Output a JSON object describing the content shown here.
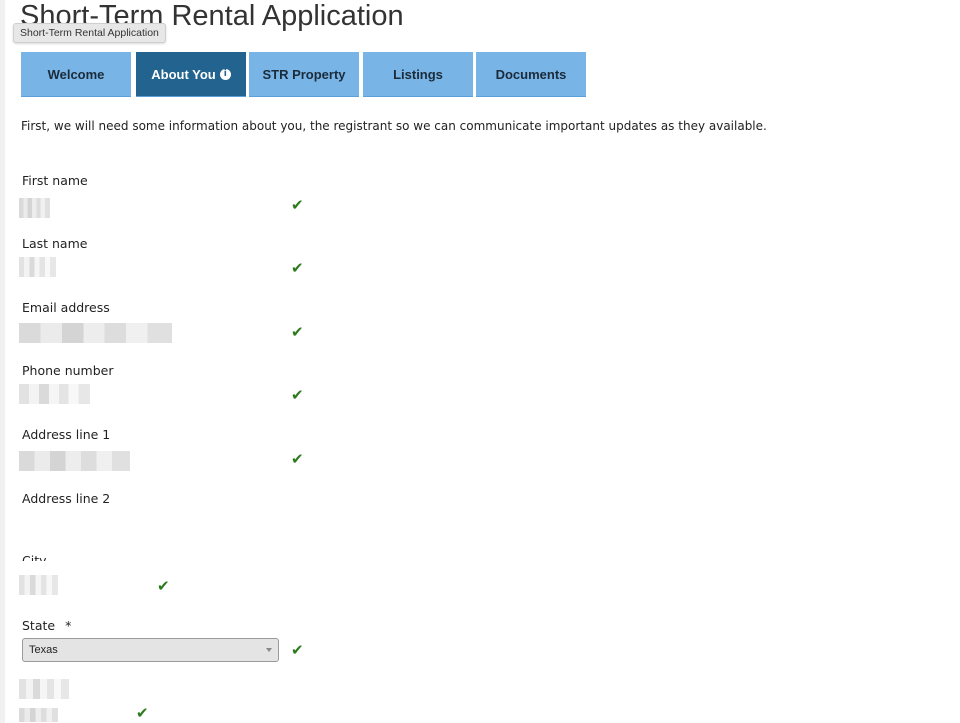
{
  "page": {
    "title": "Short-Term Rental Application",
    "tooltip": "Short-Term Rental Application"
  },
  "tabs": [
    {
      "label": "Welcome",
      "active": false
    },
    {
      "label": "About You",
      "active": true,
      "icon": "info-icon"
    },
    {
      "label": "STR Property",
      "active": false
    },
    {
      "label": "Listings",
      "active": false
    },
    {
      "label": "Documents",
      "active": false
    }
  ],
  "colors": {
    "tab_inactive": "#78b4e6",
    "tab_active": "#22638f",
    "check": "#2b7a1c"
  },
  "intro": "First, we will need some information about you, the registrant so we can communicate important updates as they available.",
  "fields": {
    "first_name": {
      "label": "First name",
      "valid": true
    },
    "last_name": {
      "label": "Last name",
      "valid": true
    },
    "email": {
      "label": "Email address",
      "valid": true
    },
    "phone": {
      "label": "Phone number",
      "valid": true
    },
    "address1": {
      "label": "Address line 1",
      "valid": true
    },
    "address2": {
      "label": "Address line 2"
    },
    "city": {
      "label": "City",
      "valid": true
    },
    "state": {
      "label": "State",
      "required_mark": "*",
      "value": "Texas",
      "valid": true
    },
    "zip": {
      "valid": true
    }
  },
  "check_glyph": "✔"
}
